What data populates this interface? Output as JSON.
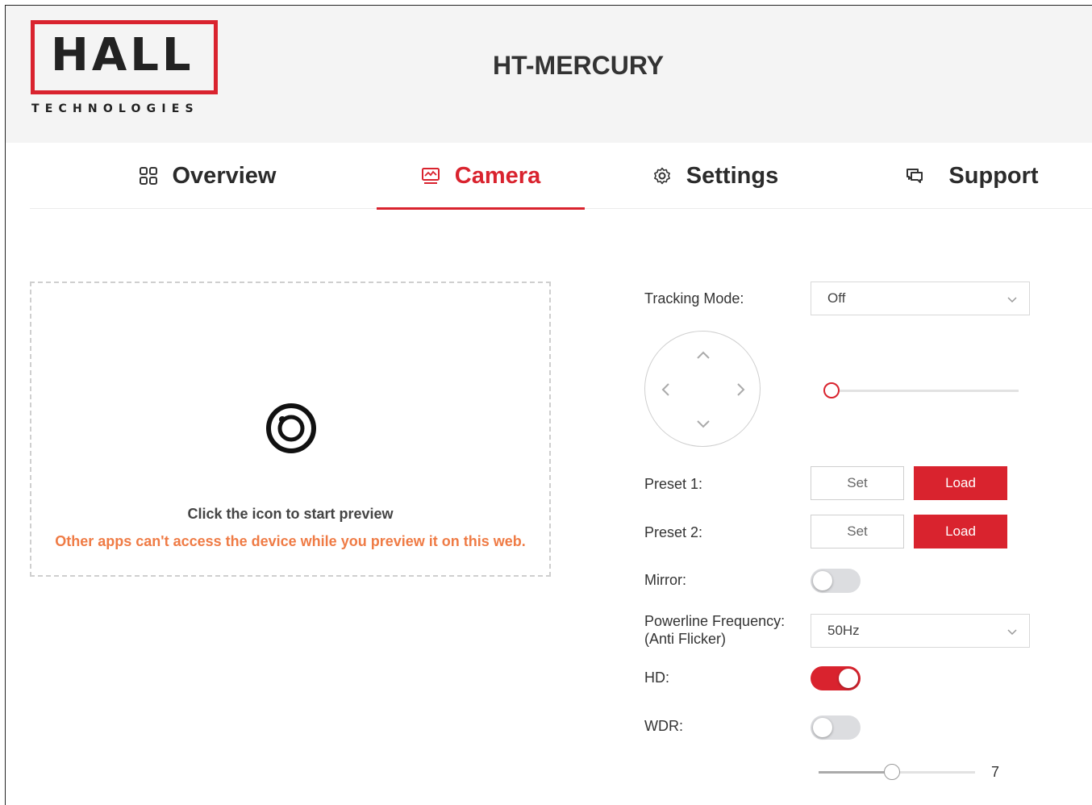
{
  "brand": {
    "logo_word": "HALL",
    "logo_sub": "TECHNOLOGIES",
    "accent_color": "#d9232e"
  },
  "header": {
    "title": "HT-MERCURY"
  },
  "tabs": [
    {
      "label": "Overview",
      "icon": "grid-icon",
      "active": false
    },
    {
      "label": "Camera",
      "icon": "monitor-icon",
      "active": true
    },
    {
      "label": "Settings",
      "icon": "gear-icon",
      "active": false
    },
    {
      "label": "Support",
      "icon": "chat-icon",
      "active": false
    }
  ],
  "preview": {
    "icon": "camera-lens-icon",
    "hint": "Click the icon to start preview",
    "warning": "Other apps can't access the device while you preview it on this web.",
    "warning_color": "#ef7b45"
  },
  "controls": {
    "tracking_mode": {
      "label": "Tracking Mode:",
      "value": "Off"
    },
    "zoom_slider": {
      "value_fraction": 0.0
    },
    "preset1": {
      "label": "Preset 1:",
      "set_label": "Set",
      "load_label": "Load"
    },
    "preset2": {
      "label": "Preset 2:",
      "set_label": "Set",
      "load_label": "Load"
    },
    "mirror": {
      "label": "Mirror:",
      "on": false
    },
    "powerline": {
      "label_line1": "Powerline Frequency:",
      "label_line2": "(Anti Flicker)",
      "value": "50Hz"
    },
    "hd": {
      "label": "HD:",
      "on": true
    },
    "wdr": {
      "label": "WDR:",
      "on": false
    },
    "wdr_level": {
      "value": "7",
      "value_fraction": 0.47
    }
  }
}
